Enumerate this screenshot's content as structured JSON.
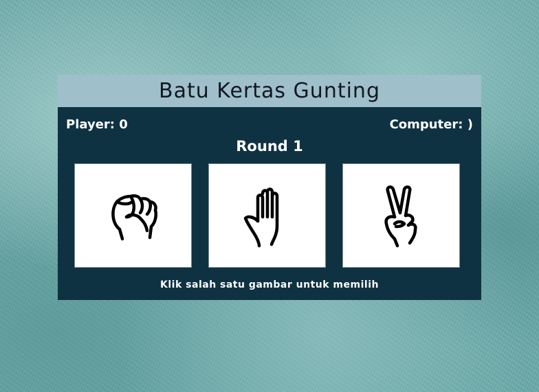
{
  "game": {
    "title": "Batu Kertas Gunting",
    "player_score": "Player: 0",
    "computer_score": "Computer: )",
    "round": "Round 1",
    "hint": "Klik salah satu gambar untuk memilih"
  },
  "choices": [
    {
      "name": "rock",
      "icon": "fist-icon"
    },
    {
      "name": "paper",
      "icon": "open-hand-icon"
    },
    {
      "name": "scissors",
      "icon": "peace-hand-icon"
    }
  ],
  "colors": {
    "panel": "#0f3242",
    "title_bar": "#9fbfca",
    "card": "#ffffff",
    "text": "#ffffff"
  }
}
